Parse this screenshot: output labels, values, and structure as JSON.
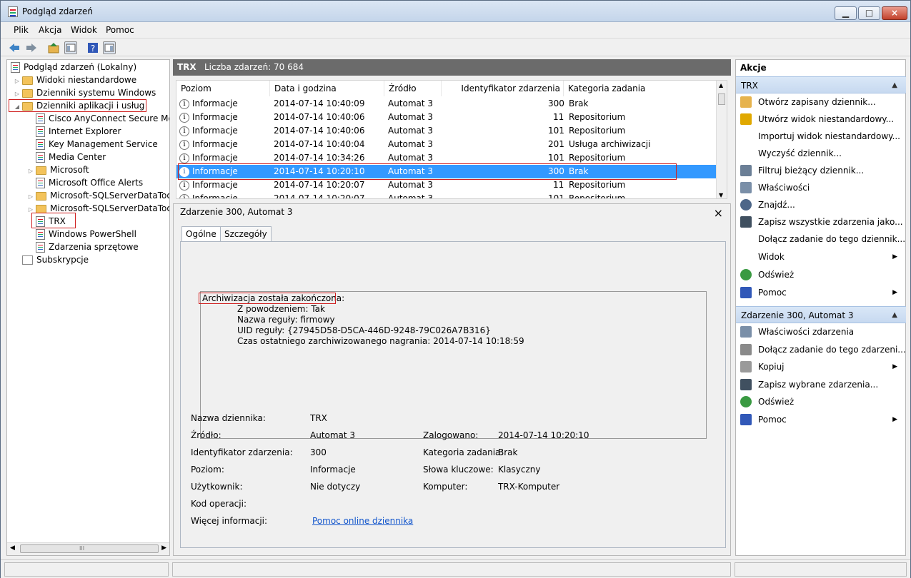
{
  "window": {
    "title": "Podgląd zdarzeń"
  },
  "menus": [
    "Plik",
    "Akcja",
    "Widok",
    "Pomoc"
  ],
  "tree": {
    "root": "Podgląd zdarzeń (Lokalny)",
    "items": [
      {
        "label": "Widoki niestandardowe",
        "expander": "▷"
      },
      {
        "label": "Dzienniki systemu Windows",
        "expander": "▷"
      },
      {
        "label": "Dzienniki aplikacji i usług",
        "expander": "◢"
      },
      {
        "label": "Cisco AnyConnect Secure Mob",
        "expander": ""
      },
      {
        "label": "Internet Explorer",
        "expander": ""
      },
      {
        "label": "Key Management Service",
        "expander": ""
      },
      {
        "label": "Media Center",
        "expander": ""
      },
      {
        "label": "Microsoft",
        "expander": "▷"
      },
      {
        "label": "Microsoft Office Alerts",
        "expander": ""
      },
      {
        "label": "Microsoft-SQLServerDataTools",
        "expander": "▷"
      },
      {
        "label": "Microsoft-SQLServerDataTools",
        "expander": "▷"
      },
      {
        "label": "TRX",
        "expander": ""
      },
      {
        "label": "Windows PowerShell",
        "expander": ""
      },
      {
        "label": "Zdarzenia sprzętowe",
        "expander": ""
      },
      {
        "label": "Subskrypcje",
        "expander": ""
      }
    ],
    "scrollbar_marker": "III"
  },
  "log": {
    "name": "TRX",
    "count_label": "Liczba zdarzeń: 70 684"
  },
  "events": {
    "headers": [
      "Poziom",
      "Data i godzina",
      "Źródło",
      "Identyfikator zdarzenia",
      "Kategoria zadania"
    ],
    "rows": [
      [
        "Informacje",
        "2014-07-14 10:40:09",
        "Automat 3",
        "300",
        "Brak"
      ],
      [
        "Informacje",
        "2014-07-14 10:40:06",
        "Automat 3",
        "11",
        "Repositorium"
      ],
      [
        "Informacje",
        "2014-07-14 10:40:06",
        "Automat 3",
        "101",
        "Repositorium"
      ],
      [
        "Informacje",
        "2014-07-14 10:40:04",
        "Automat 3",
        "201",
        "Usługa archiwizacji"
      ],
      [
        "Informacje",
        "2014-07-14 10:34:26",
        "Automat 3",
        "101",
        "Repositorium"
      ],
      [
        "Informacje",
        "2014-07-14 10:20:10",
        "Automat 3",
        "300",
        "Brak"
      ],
      [
        "Informacje",
        "2014-07-14 10:20:07",
        "Automat 3",
        "11",
        "Repositorium"
      ],
      [
        "Informacje",
        "2014-07-14 10:20:07",
        "Automat 3",
        "101",
        "Repositorium"
      ]
    ]
  },
  "details": {
    "title": "Zdarzenie 300, Automat 3",
    "tabs": [
      "Ogólne",
      "Szczegóły"
    ],
    "message": [
      "Archiwizacja została zakończona:",
      "Z powodzeniem: Tak",
      "Nazwa reguły: firmowy",
      "UID reguły: {27945D58-D5CA-446D-9248-79C026A7B316}",
      "Czas ostatniego zarchiwizowanego nagrania: 2014-07-14 10:18:59"
    ],
    "properties": {
      "log_name_label": "Nazwa dziennika:",
      "log_name": "TRX",
      "source_label": "Źródło:",
      "source": "Automat 3",
      "logged_label": "Zalogowano:",
      "logged": "2014-07-14 10:20:10",
      "event_id_label": "Identyfikator zdarzenia:",
      "event_id": "300",
      "task_category_label": "Kategoria zadania:",
      "task_category": "Brak",
      "level_label": "Poziom:",
      "level": "Informacje",
      "keywords_label": "Słowa kluczowe:",
      "keywords": "Klasyczny",
      "user_label": "Użytkownik:",
      "user": "Nie dotyczy",
      "computer_label": "Komputer:",
      "computer": "TRX-Komputer",
      "opcode_label": "Kod operacji:",
      "more_info_label": "Więcej informacji:",
      "more_info_link": "Pomoc online dziennika"
    }
  },
  "actions": {
    "header": "Akcje",
    "section1": "TRX",
    "items1": [
      {
        "label": "Otwórz zapisany dziennik...",
        "icon": "folder-open-icon",
        "color": "#e6b34d",
        "submenu": ""
      },
      {
        "label": "Utwórz widok niestandardowy...",
        "icon": "filter-create-icon",
        "color": "#e0a800",
        "submenu": ""
      },
      {
        "label": "Importuj widok niestandardowy...",
        "icon": "",
        "color": "",
        "submenu": ""
      },
      {
        "label": "Wyczyść dziennik...",
        "icon": "",
        "color": "",
        "submenu": ""
      },
      {
        "label": "Filtruj bieżący dziennik...",
        "icon": "filter-icon",
        "color": "#6b7f96",
        "submenu": ""
      },
      {
        "label": "Właściwości",
        "icon": "properties-icon",
        "color": "#7a8fa8",
        "submenu": ""
      },
      {
        "label": "Znajdź...",
        "icon": "find-icon",
        "color": "#4d6688",
        "submenu": ""
      },
      {
        "label": "Zapisz wszystkie zdarzenia jako...",
        "icon": "save-icon",
        "color": "#405060",
        "submenu": ""
      },
      {
        "label": "Dołącz zadanie do tego dziennik...",
        "icon": "",
        "color": "",
        "submenu": ""
      },
      {
        "label": "Widok",
        "icon": "",
        "color": "",
        "submenu": "▶"
      },
      {
        "label": "Odśwież",
        "icon": "refresh-icon",
        "color": "#3a9a42",
        "submenu": ""
      },
      {
        "label": "Pomoc",
        "icon": "help-icon",
        "color": "#3158b8",
        "submenu": "▶"
      }
    ],
    "section2": "Zdarzenie 300, Automat 3",
    "items2": [
      {
        "label": "Właściwości zdarzenia",
        "icon": "properties-icon",
        "color": "#7a8fa8",
        "submenu": ""
      },
      {
        "label": "Dołącz zadanie do tego zdarzeni...",
        "icon": "task-icon",
        "color": "#8a8a8a",
        "submenu": ""
      },
      {
        "label": "Kopiuj",
        "icon": "copy-icon",
        "color": "#9a9a9a",
        "submenu": "▶"
      },
      {
        "label": "Zapisz wybrane zdarzenia...",
        "icon": "save-icon",
        "color": "#405060",
        "submenu": ""
      },
      {
        "label": "Odśwież",
        "icon": "refresh-icon",
        "color": "#3a9a42",
        "submenu": ""
      },
      {
        "label": "Pomoc",
        "icon": "help-icon",
        "color": "#3158b8",
        "submenu": "▶"
      }
    ]
  },
  "colors": {
    "selection": "#3399ff",
    "highlight_box": "#d02020",
    "link": "#1155cc"
  }
}
